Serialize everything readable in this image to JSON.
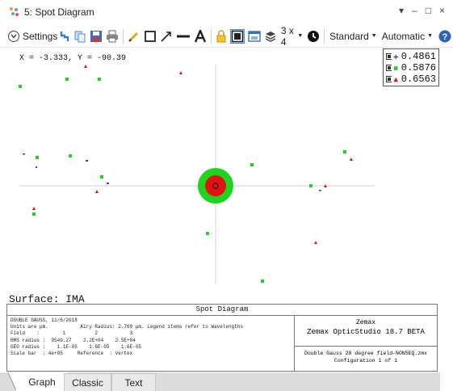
{
  "window": {
    "title": "5: Spot Diagram",
    "controls": [
      "▾",
      "–",
      "□",
      "×"
    ]
  },
  "toolbar": {
    "settings_label": "Settings",
    "layout_label": "3 x 4",
    "standard_label": "Standard",
    "automatic_label": "Automatic"
  },
  "plot": {
    "coord_readout": "X = -3.333, Y = -90.39",
    "surface_label": "Surface: IMA",
    "legend": [
      {
        "label": "0.4861",
        "color": "#3030d0",
        "marker": "plus"
      },
      {
        "label": "0.5876",
        "color": "#22cc22",
        "marker": "square"
      },
      {
        "label": "0.6563",
        "color": "#e01010",
        "marker": "triangle"
      }
    ],
    "colors": {
      "blue": "#3a3ad8",
      "green": "#1fd41f",
      "red": "#e31212",
      "axis": "#c8c8c8"
    }
  },
  "info": {
    "header": "Spot Diagram",
    "left_lines": [
      "DOUBLE GAUSS, 11/6/2018",
      "Units are µm.           Airy Radius: 2.769 µm. Legend items refer to Wavelengths",
      "Field    :        1          2           3",
      "RMS radius :  9549.27    2.2E+04    2.5E+04",
      "GEO radius :    1.1E-05    1.6E-05    1.6E-05",
      "Scale bar  : 4e+05     Reference  : Vertex"
    ],
    "company": "Zemax",
    "product": "Zemax OpticStudio 18.7  BETA",
    "file": "Double Gauss 28 degree field-NONSEQ.zmx",
    "config": "Configuration 1 of 1"
  },
  "tabs": [
    "Graph",
    "Classic",
    "Text"
  ]
}
